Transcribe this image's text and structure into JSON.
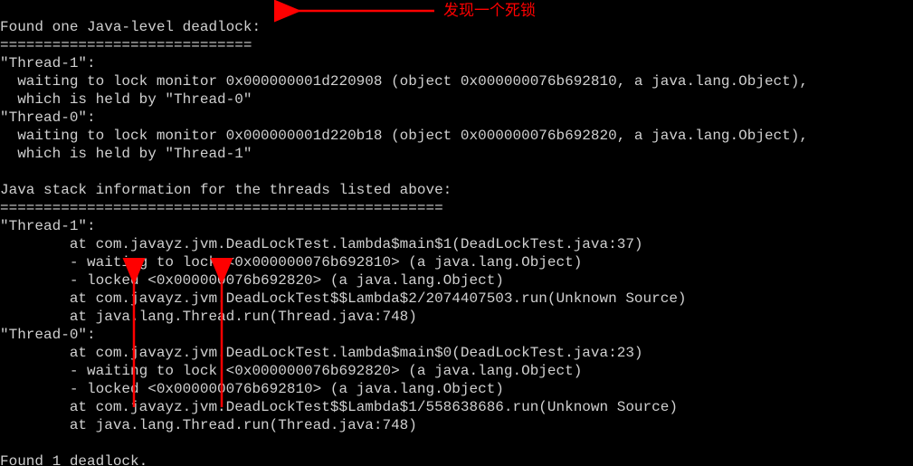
{
  "lines": {
    "l0": "Found one Java-level deadlock:",
    "l1": "=============================",
    "l2": "\"Thread-1\":",
    "l3": "  waiting to lock monitor 0x000000001d220908 (object 0x000000076b692810, a java.lang.Object),",
    "l4": "  which is held by \"Thread-0\"",
    "l5": "\"Thread-0\":",
    "l6": "  waiting to lock monitor 0x000000001d220b18 (object 0x000000076b692820, a java.lang.Object),",
    "l7": "  which is held by \"Thread-1\"",
    "l8": "",
    "l9": "Java stack information for the threads listed above:",
    "l10": "===================================================",
    "l11": "\"Thread-1\":",
    "l12": "        at com.javayz.jvm.DeadLockTest.lambda$main$1(DeadLockTest.java:37)",
    "l13": "        - waiting to lock <0x000000076b692810> (a java.lang.Object)",
    "l14": "        - locked <0x000000076b692820> (a java.lang.Object)",
    "l15": "        at com.javayz.jvm.DeadLockTest$$Lambda$2/2074407503.run(Unknown Source)",
    "l16": "        at java.lang.Thread.run(Thread.java:748)",
    "l17": "\"Thread-0\":",
    "l18": "        at com.javayz.jvm.DeadLockTest.lambda$main$0(DeadLockTest.java:23)",
    "l19": "        - waiting to lock <0x000000076b692820> (a java.lang.Object)",
    "l20": "        - locked <0x000000076b692810> (a java.lang.Object)",
    "l21": "        at com.javayz.jvm.DeadLockTest$$Lambda$1/558638686.run(Unknown Source)",
    "l22": "        at java.lang.Thread.run(Thread.java:748)",
    "l23": "",
    "l24": "Found 1 deadlock."
  },
  "annotation": {
    "label": "发现一个死锁"
  }
}
